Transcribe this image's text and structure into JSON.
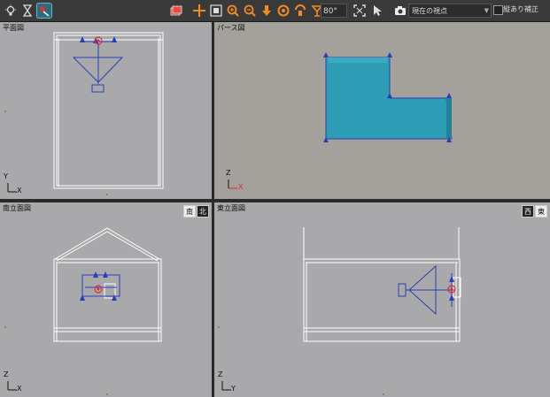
{
  "toolbar": {
    "buttons": [
      {
        "icon": "light-bulb-icon"
      },
      {
        "icon": "hourglass-icon"
      },
      {
        "icon": "walkthrough-icon",
        "active": true
      },
      {
        "icon": "layers-icon"
      },
      {
        "icon": "move-icon"
      },
      {
        "icon": "frame-icon"
      },
      {
        "icon": "zoom-in-icon"
      },
      {
        "icon": "zoom-out-icon"
      },
      {
        "icon": "arrow-down-icon"
      },
      {
        "icon": "rotate-icon"
      },
      {
        "icon": "tilt-icon"
      },
      {
        "icon": "angle-icon"
      },
      {
        "icon": "fit-icon"
      },
      {
        "icon": "pointer-icon"
      }
    ],
    "angle_value": "80°",
    "view_select_value": "現在の視点",
    "check_label": "縦あり補正"
  },
  "viewports": {
    "plan": {
      "label": "平面図",
      "axis_v": "Y",
      "axis_h": "X"
    },
    "perspective": {
      "label": "パース図",
      "axis_v": "Z",
      "axis_h": "X"
    },
    "south": {
      "label": "南立面図",
      "dir_left": "南",
      "dir_right": "北",
      "axis_v": "Z",
      "axis_h": "X"
    },
    "east": {
      "label": "東立面図",
      "dir_left": "西",
      "dir_right": "東",
      "axis_v": "Z",
      "axis_h": "Y"
    }
  },
  "colors": {
    "accent": "#f08a24",
    "wire": "#ffffff",
    "object": "#2a3fb0",
    "object_fill": "#2e9db6",
    "marker": "#e03030",
    "axis_red": "#d03030"
  }
}
